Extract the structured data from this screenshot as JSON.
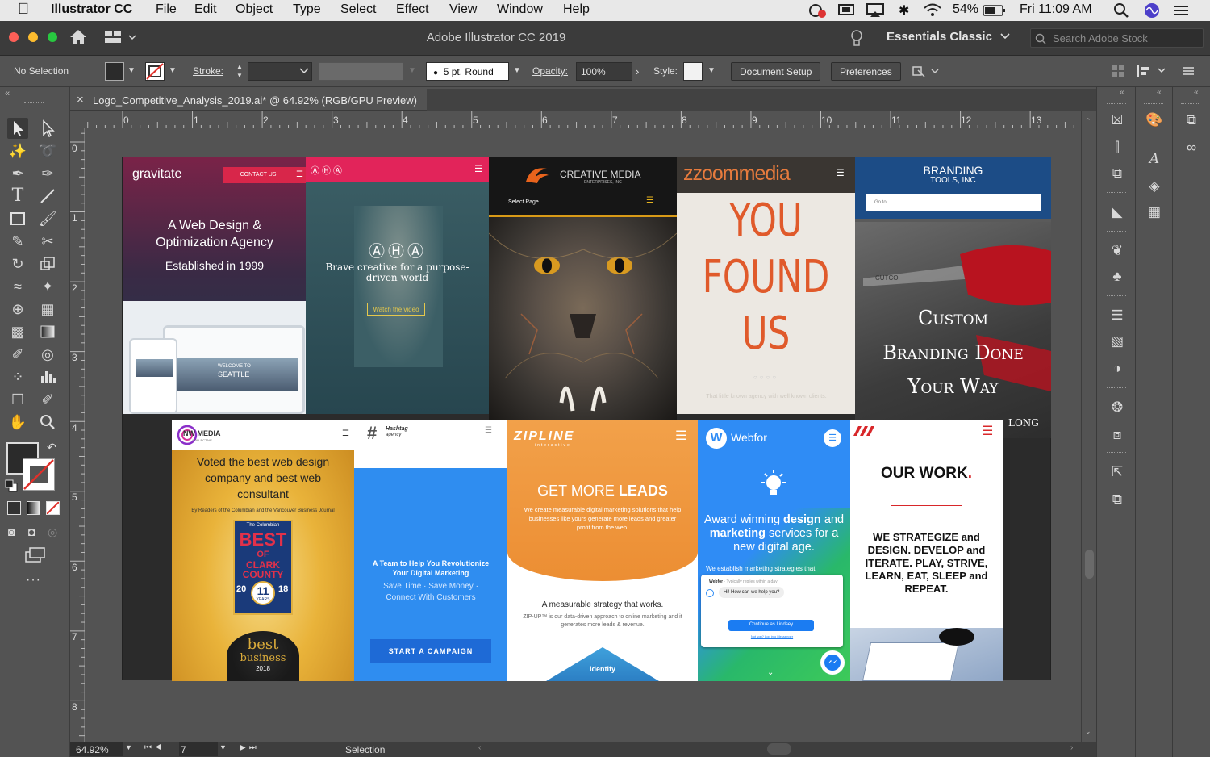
{
  "menubar": {
    "app_name": "Illustrator CC",
    "items": [
      "File",
      "Edit",
      "Object",
      "Type",
      "Select",
      "Effect",
      "View",
      "Window",
      "Help"
    ],
    "battery": "54%",
    "clock": "Fri 11:09 AM"
  },
  "window": {
    "title": "Adobe Illustrator CC 2019",
    "workspace": "Essentials Classic",
    "stock_placeholder": "Search Adobe Stock"
  },
  "control": {
    "selection": "No Selection",
    "stroke_label": "Stroke:",
    "brush": "5 pt. Round",
    "opacity_label": "Opacity:",
    "opacity_value": "100%",
    "style_label": "Style:",
    "document_setup": "Document Setup",
    "preferences": "Preferences"
  },
  "document": {
    "tab_title": "Logo_Competitive_Analysis_2019.ai* @ 64.92% (RGB/GPU Preview)",
    "ruler_h": [
      "0",
      "1",
      "2",
      "3",
      "4",
      "5",
      "6",
      "7",
      "8",
      "9",
      "10",
      "11",
      "12",
      "13"
    ],
    "ruler_v": [
      "0",
      "1",
      "2",
      "3",
      "4",
      "5",
      "6",
      "7",
      "8"
    ]
  },
  "status": {
    "zoom": "64.92%",
    "artboard_number": "7",
    "tool": "Selection"
  },
  "artboard": {
    "gravitate": {
      "logo": "gravitate",
      "contact": "CONTACT US",
      "headline": "A Web Design & Optimization Agency",
      "established": "Established in 1999",
      "seattle": "SEATTLE",
      "welcome": "WELCOME TO"
    },
    "aha": {
      "logo": "AHA",
      "tagline": "Brave creative for a purpose-driven world",
      "button": "Watch the video"
    },
    "creative_media": {
      "name": "CREATIVE MEDIA",
      "sub": "ENTERPRISES, INC",
      "menu": "Select Page"
    },
    "zzoom": {
      "logo": "zzoommedia",
      "headline1": "YOU",
      "headline2": "FOUND",
      "headline3": "US",
      "sub": "That little known agency with well known clients."
    },
    "branding": {
      "logo1": "BRANDING",
      "logo2": "TOOLS, INC",
      "goto": "Go to...",
      "line1": "Custom",
      "line2": "Branding Done",
      "line3": "Your Way",
      "tail": "LONG",
      "knife": "CUTCO"
    },
    "nwmedia": {
      "logo": "NW MEDIA",
      "logo_sub": "COLLECTIVE",
      "headline": "Voted the best web design company and best web consultant",
      "by": "By Readers of the Columbian and the Vancouver Business Journal",
      "paper": "The Columbian",
      "best": "BEST",
      "of": "OF",
      "clark": "CLARK COUNTY",
      "year_left": "20",
      "year_right": "18",
      "eleven": "11",
      "years": "YEARS",
      "best_in": "best",
      "business": "business",
      "badge_year": "2018"
    },
    "hashtag": {
      "logo": "Hashtag",
      "logo_sub": "agency",
      "headline": "A Team to Help You Revolutionize Your Digital Marketing",
      "sub": "Save Time · Save Money · Connect With Customers",
      "button": "START A CAMPAIGN"
    },
    "zipline": {
      "logo": "ZIPLINE",
      "logo_sub": "interactive",
      "headline1": "GET MORE ",
      "headline2": "LEADS",
      "body": "We create measurable digital marketing solutions that help businesses like yours generate more leads and greater profit from the web.",
      "strategy": "A measurable strategy that works.",
      "strategy_body": "ZIP-UP™ is our data-driven approach to online marketing and it generates more leads & revenue.",
      "identify": "Identify"
    },
    "webfor": {
      "logo": "Webfor",
      "head1": "Award winning ",
      "head2": "design",
      "head3": "and ",
      "head4": "marketing",
      "head5": " services for a new digital age.",
      "strip": "We establish marketing strategies that",
      "chat_name": "Webfor",
      "chat_status": " · Typically replies within a day",
      "chat_msg": "Hi! How can we help you?",
      "chat_btn": "Continue as Lindsey",
      "chat_link": "Not you? Log into Messenger"
    },
    "ourwork": {
      "title": "OUR WORK",
      "dot": ".",
      "body": "WE STRATEGIZE and DESIGN. DEVELOP and ITERATE. PLAY, STRIVE, LEARN, EAT, SLEEP and REPEAT."
    }
  },
  "colors": {
    "accent": "#e0422f",
    "panel": "#535353",
    "zzoom_orange": "#e05a2b",
    "zipline_orange": "#f0963a",
    "hashtag_blue": "#2f8df0",
    "webfor_blue": "#2f8cf5"
  }
}
